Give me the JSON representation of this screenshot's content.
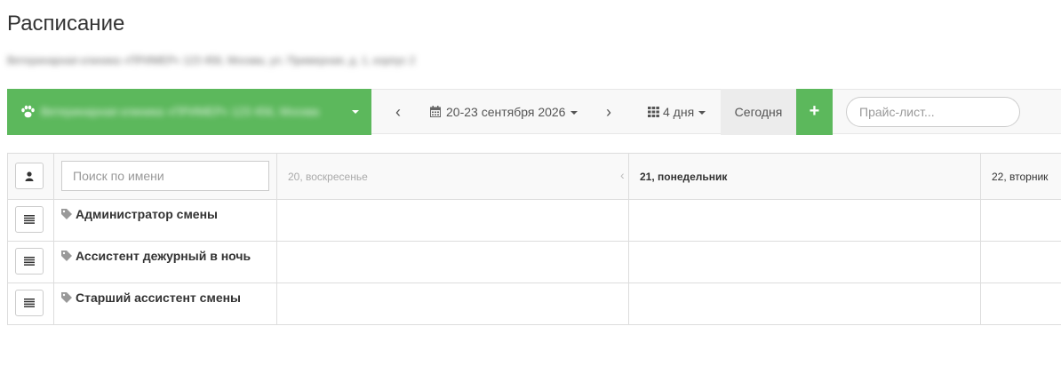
{
  "page": {
    "title": "Расписание",
    "subtitle": "Ветеринарная клиника «ПРИМЕР» 123 456, Москва, ул. Примерная, д. 1, корпус 2"
  },
  "toolbar": {
    "clinic_name": "Ветеринарная клиника «ПРИМЕР» 123 456, Москва",
    "prev_label": "‹",
    "next_label": "›",
    "date_range": "20-23 сентября 2026",
    "days_label": "4 дня",
    "today_label": "Сегодня",
    "add_label": "+",
    "price_placeholder": "Прайс-лист...",
    "accent_color": "#5cb85c"
  },
  "schedule": {
    "search_placeholder": "Поиск по имени",
    "days": [
      {
        "label": "20, воскресенье",
        "state": "past"
      },
      {
        "label": "21, понедельник",
        "state": "today"
      },
      {
        "label": "22, вторник",
        "state": "future"
      }
    ],
    "rows": [
      {
        "label": "Администратор смены"
      },
      {
        "label": "Ассистент дежурный в ночь"
      },
      {
        "label": "Старший ассистент смены"
      }
    ]
  }
}
